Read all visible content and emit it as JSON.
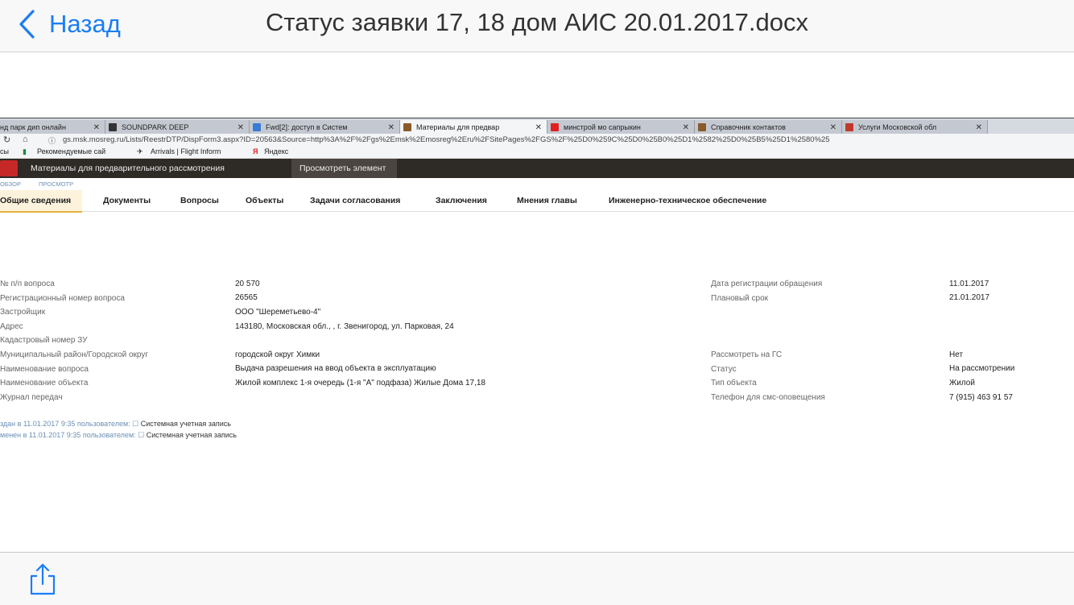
{
  "navbar": {
    "back_label": "Назад",
    "title": "Статус заявки 17, 18 дом АИС 20.01.2017.docx"
  },
  "browser": {
    "tabs": [
      {
        "label": "нд парк дип онлайн",
        "active": false
      },
      {
        "label": "SOUNDPARK DEEP",
        "active": false
      },
      {
        "label": "Fwd[2]: доступ в Систем",
        "active": false
      },
      {
        "label": "Материалы для предвар",
        "active": true
      },
      {
        "label": "минстрой мо сапрыкин",
        "active": false
      },
      {
        "label": "Справочник контактов",
        "active": false
      },
      {
        "label": "Услуги Московской обл",
        "active": false
      }
    ],
    "url": "gs.msk.mosreg.ru/Lists/ReestrDTP/DispForm3.aspx?ID=20563&Source=http%3A%2F%2Fgs%2Emsk%2Emosreg%2Eru%2FSitePages%2FGS%2F%25D0%259C%25D0%25B0%25D1%2582%25D0%25B5%25D1%2580%25",
    "bookmarks": [
      "сы",
      "Рекомендуемые сай",
      "Arrivals | Flight Inform",
      "Яндекс"
    ]
  },
  "site": {
    "breadcrumb": [
      "Материалы для предварительного рассмотрения",
      "Просмотреть элемент"
    ],
    "subnav": [
      "ОБЗОР",
      "ПРОСМОТР"
    ],
    "section_tabs": [
      "Общие сведения",
      "Документы",
      "Вопросы",
      "Объекты",
      "Задачи согласования",
      "Заключения",
      "Мнения главы",
      "Инженерно-техническое обеспечение"
    ],
    "left_fields": [
      {
        "label": "№ п/п вопроса",
        "value": "20 570"
      },
      {
        "label": "Регистрационный номер вопроса",
        "value": "26565"
      },
      {
        "label": "Застройщик",
        "value": "ООО \"Шереметьево-4\""
      },
      {
        "label": "Адрес",
        "value": "143180, Московская обл., , г. Звенигород, ул. Парковая, 24"
      },
      {
        "label": "Кадастровый номер ЗУ",
        "value": ""
      },
      {
        "label": "Муниципальный район/Городской округ",
        "value": "городской округ Химки"
      },
      {
        "label": "Наименование вопроса",
        "value": "Выдача разрешения на ввод объекта в эксплуатацию"
      },
      {
        "label": "Наименование объекта",
        "value": "Жилой комплекс 1-я очередь (1-я \"А\" подфаза) Жилые Дома 17,18"
      },
      {
        "label": "Журнал передач",
        "value": ""
      }
    ],
    "right_fields": [
      {
        "label": "Дата регистрации обращения",
        "value": "11.01.2017"
      },
      {
        "label": "Плановый срок",
        "value": "21.01.2017"
      },
      {
        "label": "Рассмотреть на ГС",
        "value": "Нет"
      },
      {
        "label": "Статус",
        "value": "На рассмотрении"
      },
      {
        "label": "Тип объекта",
        "value": "Жилой"
      },
      {
        "label": "Телефон для смс-оповещения",
        "value": "7 (915) 463 91 57"
      }
    ],
    "meta": [
      {
        "prefix": "здан в 11.01.2017 9:35  пользователем:",
        "user": "Системная учетная запись"
      },
      {
        "prefix": "менен в 11.01.2017 9:35  пользователем:",
        "user": "Системная учетная запись"
      }
    ]
  }
}
